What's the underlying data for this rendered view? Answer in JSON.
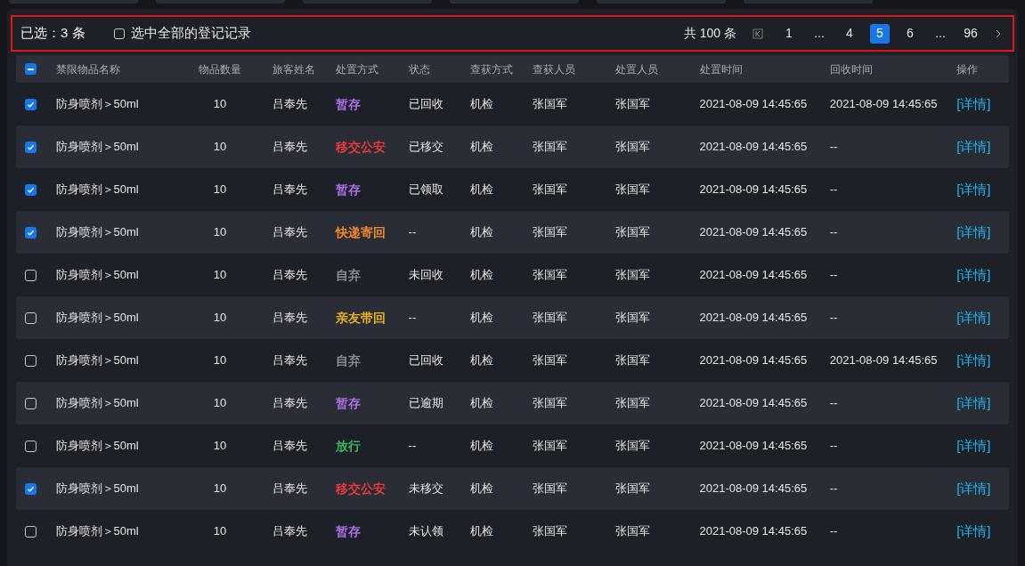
{
  "selection_bar": {
    "selected_label": "已选：3 条",
    "select_all": {
      "label": "选中全部的登记记录",
      "checked": false
    }
  },
  "pagination": {
    "total": "共 100 条",
    "pages": [
      {
        "label": "1",
        "selected": false
      },
      {
        "label": "...",
        "selected": false
      },
      {
        "label": "4",
        "selected": false
      },
      {
        "label": "5",
        "selected": true
      },
      {
        "label": "6",
        "selected": false
      },
      {
        "label": "...",
        "selected": false
      },
      {
        "label": "96",
        "selected": false
      }
    ]
  },
  "table": {
    "header_checkbox": {
      "indeterminate": true
    },
    "columns": [
      "禁限物品名称",
      "物品数量",
      "旅客姓名",
      "处置方式",
      "状态",
      "查获方式",
      "查获人员",
      "处置人员",
      "处置时间",
      "回收时间",
      "操作"
    ],
    "rows": [
      {
        "checked": true,
        "name": "防身喷剂＞50ml",
        "qty": "10",
        "passenger": "吕奉先",
        "method": "暂存",
        "color": "#a970e0",
        "status": "已回收",
        "find": "机检",
        "finder": "张国军",
        "handler": "张国军",
        "time": "2021-08-09 14:45:65",
        "recovery": "2021-08-09 14:45:65",
        "action": "[详情]"
      },
      {
        "checked": true,
        "name": "防身喷剂＞50ml",
        "qty": "10",
        "passenger": "吕奉先",
        "method": "移交公安",
        "color": "#e8383d",
        "status": "已移交",
        "find": "机检",
        "finder": "张国军",
        "handler": "张国军",
        "time": "2021-08-09 14:45:65",
        "recovery": "--",
        "action": "[详情]"
      },
      {
        "checked": true,
        "name": "防身喷剂＞50ml",
        "qty": "10",
        "passenger": "吕奉先",
        "method": "暂存",
        "color": "#a970e0",
        "status": "已领取",
        "find": "机检",
        "finder": "张国军",
        "handler": "张国军",
        "time": "2021-08-09 14:45:65",
        "recovery": "--",
        "action": "[详情]"
      },
      {
        "checked": true,
        "name": "防身喷剂＞50ml",
        "qty": "10",
        "passenger": "吕奉先",
        "method": "快递寄回",
        "color": "#f0892b",
        "status": "--",
        "find": "机检",
        "finder": "张国军",
        "handler": "张国军",
        "time": "2021-08-09 14:45:65",
        "recovery": "--",
        "action": "[详情]"
      },
      {
        "checked": false,
        "name": "防身喷剂＞50ml",
        "qty": "10",
        "passenger": "吕奉先",
        "method": "自弃",
        "color": "#8a8c92",
        "status": "未回收",
        "find": "机检",
        "finder": "张国军",
        "handler": "张国军",
        "time": "2021-08-09 14:45:65",
        "recovery": "--",
        "action": "[详情]"
      },
      {
        "checked": false,
        "name": "防身喷剂＞50ml",
        "qty": "10",
        "passenger": "吕奉先",
        "method": "亲友带回",
        "color": "#e8b21e",
        "status": "--",
        "find": "机检",
        "finder": "张国军",
        "handler": "张国军",
        "time": "2021-08-09 14:45:65",
        "recovery": "--",
        "action": "[详情]"
      },
      {
        "checked": false,
        "name": "防身喷剂＞50ml",
        "qty": "10",
        "passenger": "吕奉先",
        "method": "自弃",
        "color": "#8a8c92",
        "status": "已回收",
        "find": "机检",
        "finder": "张国军",
        "handler": "张国军",
        "time": "2021-08-09 14:45:65",
        "recovery": "2021-08-09 14:45:65",
        "action": "[详情]"
      },
      {
        "checked": false,
        "name": "防身喷剂＞50ml",
        "qty": "10",
        "passenger": "吕奉先",
        "method": "暂存",
        "color": "#a970e0",
        "status": "已逾期",
        "find": "机检",
        "finder": "张国军",
        "handler": "张国军",
        "time": "2021-08-09 14:45:65",
        "recovery": "--",
        "action": "[详情]"
      },
      {
        "checked": false,
        "name": "防身喷剂＞50ml",
        "qty": "10",
        "passenger": "吕奉先",
        "method": "放行",
        "color": "#3cb55a",
        "status": "--",
        "find": "机检",
        "finder": "张国军",
        "handler": "张国军",
        "time": "2021-08-09 14:45:65",
        "recovery": "--",
        "action": "[详情]"
      },
      {
        "checked": true,
        "name": "防身喷剂＞50ml",
        "qty": "10",
        "passenger": "吕奉先",
        "method": "移交公安",
        "color": "#e8383d",
        "status": "未移交",
        "find": "机检",
        "finder": "张国军",
        "handler": "张国军",
        "time": "2021-08-09 14:45:65",
        "recovery": "--",
        "action": "[详情]"
      },
      {
        "checked": false,
        "name": "防身喷剂＞50ml",
        "qty": "10",
        "passenger": "吕奉先",
        "method": "暂存",
        "color": "#a970e0",
        "status": "未认领",
        "find": "机检",
        "finder": "张国军",
        "handler": "张国军",
        "time": "2021-08-09 14:45:65",
        "recovery": "--",
        "action": "[详情]"
      }
    ]
  }
}
